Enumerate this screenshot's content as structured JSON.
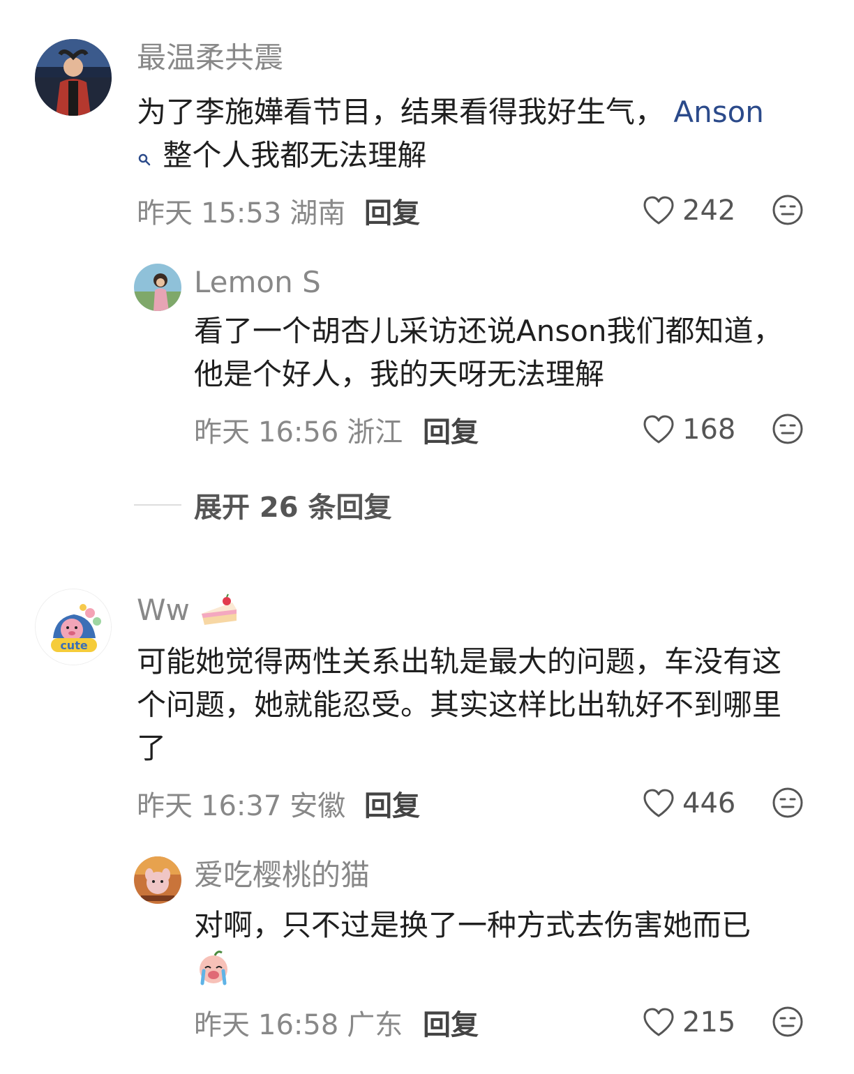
{
  "comments": [
    {
      "username": "最温柔共震",
      "content_before": "为了李施嬅看节目，结果看得我好生气，",
      "link": "Anson",
      "content_after": "整个人我都无法理解",
      "date": "昨天",
      "time": "15:53",
      "location": "湖南",
      "reply_label": "回复",
      "likes": "242"
    },
    {
      "username": "Lemon S",
      "content": "看了一个胡杏儿采访还说Anson我们都知道，他是个好人，我的天呀无法理解",
      "date": "昨天",
      "time": "16:56",
      "location": "浙江",
      "reply_label": "回复",
      "likes": "168"
    },
    {
      "username": "Ww",
      "content": "可能她觉得两性关系出轨是最大的问题，车没有这个问题，她就能忍受。其实这样比出轨好不到哪里了",
      "date": "昨天",
      "time": "16:37",
      "location": "安徽",
      "reply_label": "回复",
      "likes": "446"
    },
    {
      "username": "爱吃樱桃的猫",
      "content": "对啊，只不过是换了一种方式去伤害她而已",
      "date": "昨天",
      "time": "16:58",
      "location": "广东",
      "reply_label": "回复",
      "likes": "215"
    }
  ],
  "expand_replies": "展开 26 条回复",
  "avatar_badge_text": "cute",
  "icons": {
    "like": "heart-outline-icon",
    "dislike": "neutral-face-icon",
    "search": "search-icon"
  },
  "colors": {
    "link": "#2b4a8a",
    "username": "#888888",
    "meta": "#888888"
  }
}
